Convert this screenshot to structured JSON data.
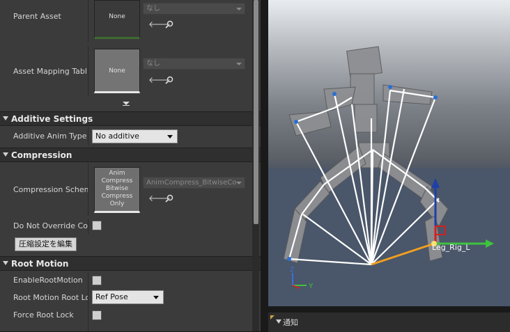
{
  "details": {
    "parent_asset": {
      "label": "Parent Asset",
      "thumb_text": "None",
      "combo_value": "なし"
    },
    "asset_mapping": {
      "label": "Asset Mapping Table",
      "thumb_text": "None",
      "combo_value": "なし"
    },
    "additive_section": {
      "title": "Additive Settings"
    },
    "additive_anim_type": {
      "label": "Additive Anim Type",
      "value": "No additive"
    },
    "compression_section": {
      "title": "Compression"
    },
    "compression_scheme": {
      "label": "Compression Scheme",
      "thumb_lines": [
        "Anim",
        "Compress",
        "Bitwise",
        "Compress",
        "Only"
      ],
      "combo_value": "AnimCompress_BitwiseCo"
    },
    "do_not_override": {
      "label": "Do Not Override Compression"
    },
    "edit_compression_button": "圧縮設定を編集",
    "root_motion_section": {
      "title": "Root Motion"
    },
    "enable_root_motion": {
      "label": "EnableRootMotion"
    },
    "root_motion_root_lock": {
      "label": "Root Motion Root Lock",
      "value": "Ref Pose"
    },
    "force_root_lock": {
      "label": "Force Root Lock"
    }
  },
  "viewport": {
    "bone_label": "Leg_Rig_L",
    "axis_y": "Y",
    "axis_z": "Z"
  },
  "notifications": {
    "label": "通知"
  }
}
